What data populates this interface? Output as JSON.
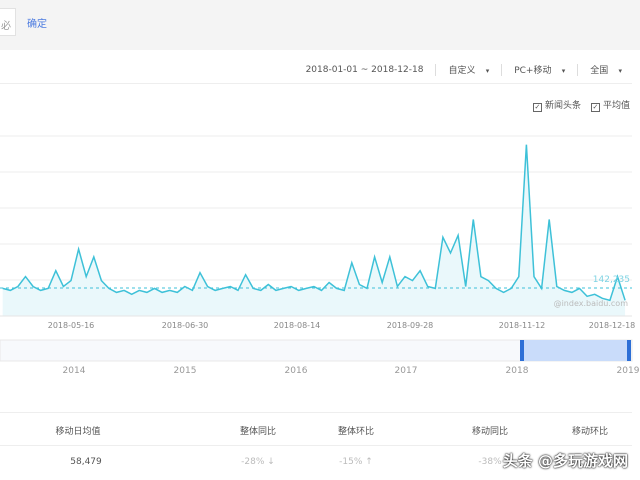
{
  "toolbar": {
    "input_fragment": "必",
    "confirm": "确定"
  },
  "filters": {
    "date_range": "2018-01-01 ~ 2018-12-18",
    "period": "自定义",
    "device": "PC+移动",
    "region": "全国"
  },
  "legend": {
    "news": "新闻头条",
    "average": "平均值",
    "news_checked": true,
    "average_checked": true
  },
  "chart_data": {
    "type": "area",
    "line_color": "#3ec1d8",
    "average": 142235,
    "average_label": "142,235",
    "watermark": "@index.baidu.com",
    "x_ticks": [
      "2018-05-16",
      "2018-06-30",
      "2018-08-14",
      "2018-09-28",
      "2018-11-12",
      "2018-12-18"
    ],
    "nav_ticks": [
      "2014",
      "2015",
      "2016",
      "2017",
      "2018",
      "2019"
    ],
    "nav_selection": [
      "2018-01-01",
      "2018-12-18"
    ],
    "points": [
      [
        "2018-04-19",
        140000
      ],
      [
        "2018-04-22",
        130000
      ],
      [
        "2018-04-25",
        150000
      ],
      [
        "2018-04-28",
        200000
      ],
      [
        "2018-05-01",
        150000
      ],
      [
        "2018-05-04",
        130000
      ],
      [
        "2018-05-07",
        140000
      ],
      [
        "2018-05-10",
        230000
      ],
      [
        "2018-05-13",
        150000
      ],
      [
        "2018-05-16",
        180000
      ],
      [
        "2018-05-19",
        340000
      ],
      [
        "2018-05-22",
        200000
      ],
      [
        "2018-05-25",
        300000
      ],
      [
        "2018-05-28",
        180000
      ],
      [
        "2018-05-31",
        140000
      ],
      [
        "2018-06-03",
        120000
      ],
      [
        "2018-06-06",
        130000
      ],
      [
        "2018-06-09",
        110000
      ],
      [
        "2018-06-12",
        130000
      ],
      [
        "2018-06-15",
        120000
      ],
      [
        "2018-06-18",
        140000
      ],
      [
        "2018-06-21",
        120000
      ],
      [
        "2018-06-24",
        130000
      ],
      [
        "2018-06-27",
        120000
      ],
      [
        "2018-06-30",
        150000
      ],
      [
        "2018-07-03",
        130000
      ],
      [
        "2018-07-06",
        220000
      ],
      [
        "2018-07-09",
        150000
      ],
      [
        "2018-07-12",
        130000
      ],
      [
        "2018-07-15",
        140000
      ],
      [
        "2018-07-18",
        150000
      ],
      [
        "2018-07-21",
        130000
      ],
      [
        "2018-07-24",
        210000
      ],
      [
        "2018-07-27",
        140000
      ],
      [
        "2018-07-30",
        130000
      ],
      [
        "2018-08-02",
        160000
      ],
      [
        "2018-08-05",
        130000
      ],
      [
        "2018-08-08",
        140000
      ],
      [
        "2018-08-11",
        150000
      ],
      [
        "2018-08-14",
        130000
      ],
      [
        "2018-08-17",
        140000
      ],
      [
        "2018-08-20",
        150000
      ],
      [
        "2018-08-23",
        130000
      ],
      [
        "2018-08-26",
        170000
      ],
      [
        "2018-08-29",
        140000
      ],
      [
        "2018-09-01",
        130000
      ],
      [
        "2018-09-04",
        270000
      ],
      [
        "2018-09-07",
        160000
      ],
      [
        "2018-09-10",
        140000
      ],
      [
        "2018-09-13",
        300000
      ],
      [
        "2018-09-16",
        170000
      ],
      [
        "2018-09-19",
        300000
      ],
      [
        "2018-09-22",
        150000
      ],
      [
        "2018-09-25",
        200000
      ],
      [
        "2018-09-28",
        180000
      ],
      [
        "2018-10-01",
        230000
      ],
      [
        "2018-10-04",
        150000
      ],
      [
        "2018-10-07",
        140000
      ],
      [
        "2018-10-10",
        400000
      ],
      [
        "2018-10-13",
        320000
      ],
      [
        "2018-10-16",
        410000
      ],
      [
        "2018-10-19",
        150000
      ],
      [
        "2018-10-22",
        490000
      ],
      [
        "2018-10-25",
        200000
      ],
      [
        "2018-10-28",
        180000
      ],
      [
        "2018-10-31",
        140000
      ],
      [
        "2018-11-03",
        120000
      ],
      [
        "2018-11-06",
        140000
      ],
      [
        "2018-11-09",
        200000
      ],
      [
        "2018-11-12",
        870000
      ],
      [
        "2018-11-15",
        200000
      ],
      [
        "2018-11-18",
        140000
      ],
      [
        "2018-11-21",
        490000
      ],
      [
        "2018-11-24",
        150000
      ],
      [
        "2018-11-27",
        130000
      ],
      [
        "2018-11-30",
        120000
      ],
      [
        "2018-12-03",
        140000
      ],
      [
        "2018-12-06",
        100000
      ],
      [
        "2018-12-09",
        110000
      ],
      [
        "2018-12-12",
        90000
      ],
      [
        "2018-12-15",
        80000
      ],
      [
        "2018-12-18",
        200000
      ],
      [
        "2018-12-21",
        80000
      ]
    ]
  },
  "table": {
    "headers": [
      "移动日均值",
      "整体同比",
      "整体环比",
      "移动同比",
      "移动环比"
    ],
    "row": [
      "58,479",
      "-28% ↓",
      "-15% ↑",
      "-38%",
      ""
    ]
  },
  "watermark": "头条 @多玩游戏网"
}
